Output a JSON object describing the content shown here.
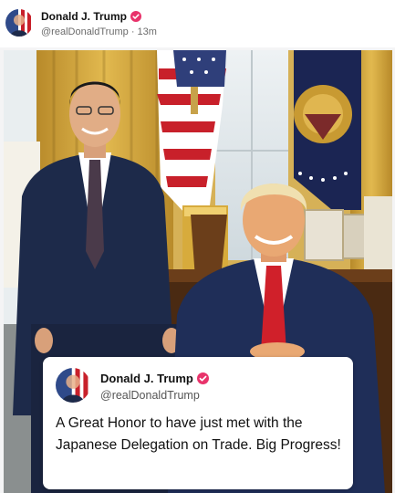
{
  "post": {
    "author_name": "Donald J. Trump",
    "handle": "@realDonaldTrump",
    "separator": "·",
    "time_ago": "13m"
  },
  "quote": {
    "author_name": "Donald J. Trump",
    "handle": "@realDonaldTrump",
    "text": "A Great Honor to have just met with the Japanese Delegation on Trade. Big Progress!"
  },
  "icons": {
    "avatar": "flag-portrait-avatar",
    "verified": "verified-badge-icon"
  },
  "colors": {
    "verified": "#e8336b",
    "suit_navy": "#1d2a4a",
    "tie_red": "#d0202a",
    "curtain_gold": "#c9a13b"
  }
}
